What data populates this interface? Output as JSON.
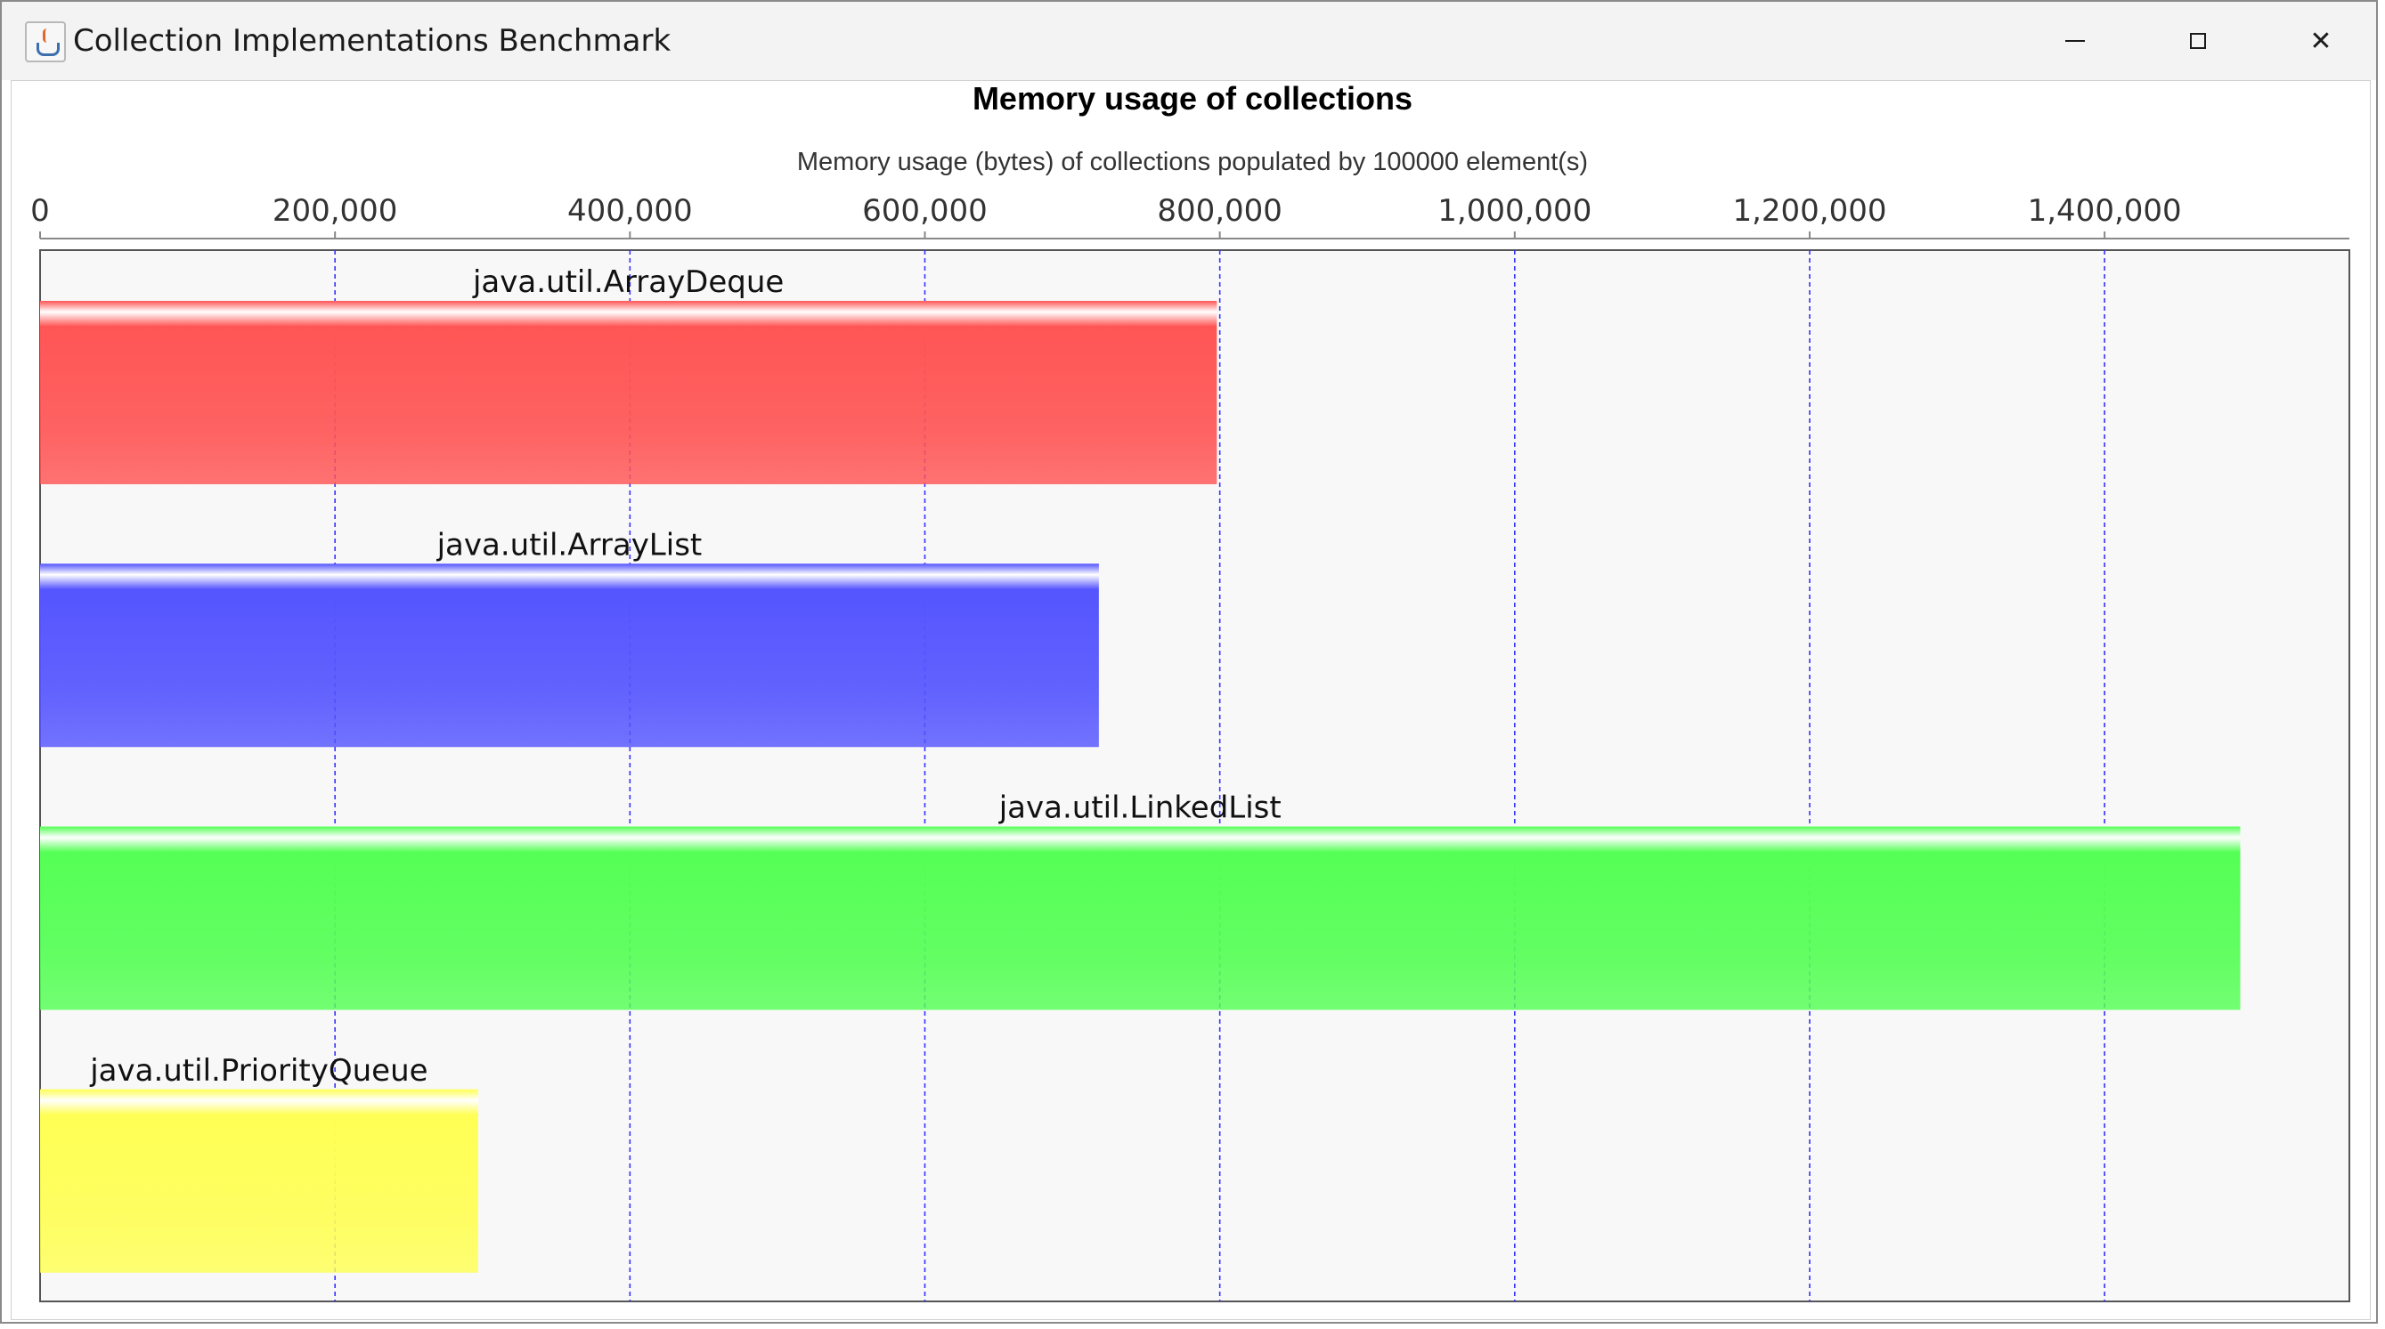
{
  "window": {
    "title": "Collection Implementations Benchmark",
    "icon": "java-coffee-cup-icon",
    "controls": {
      "minimize": "minimize-icon",
      "maximize": "maximize-icon",
      "close": "close-icon",
      "close_glyph": "✕"
    }
  },
  "chart_data": {
    "type": "bar",
    "orientation": "horizontal",
    "title": "Memory usage of collections",
    "xlabel": "Memory usage (bytes) of collections populated by 100000 element(s)",
    "ylabel": "",
    "categories": [
      "java.util.ArrayDeque",
      "java.util.ArrayList",
      "java.util.LinkedList",
      "java.util.PriorityQueue"
    ],
    "values": [
      798000,
      718000,
      1492000,
      297000
    ],
    "colors": [
      "#ff5555",
      "#5555ff",
      "#55ff55",
      "#ffff55"
    ],
    "xlim": [
      0,
      1566000
    ],
    "ticks": [
      0,
      200000,
      400000,
      600000,
      800000,
      1000000,
      1200000,
      1400000
    ],
    "tick_labels": [
      "0",
      "200,000",
      "400,000",
      "600,000",
      "800,000",
      "1,000,000",
      "1,200,000",
      "1,400,000"
    ],
    "axis_position": "top",
    "grid": true,
    "gridline_color": "#3333ff",
    "legend": false
  }
}
